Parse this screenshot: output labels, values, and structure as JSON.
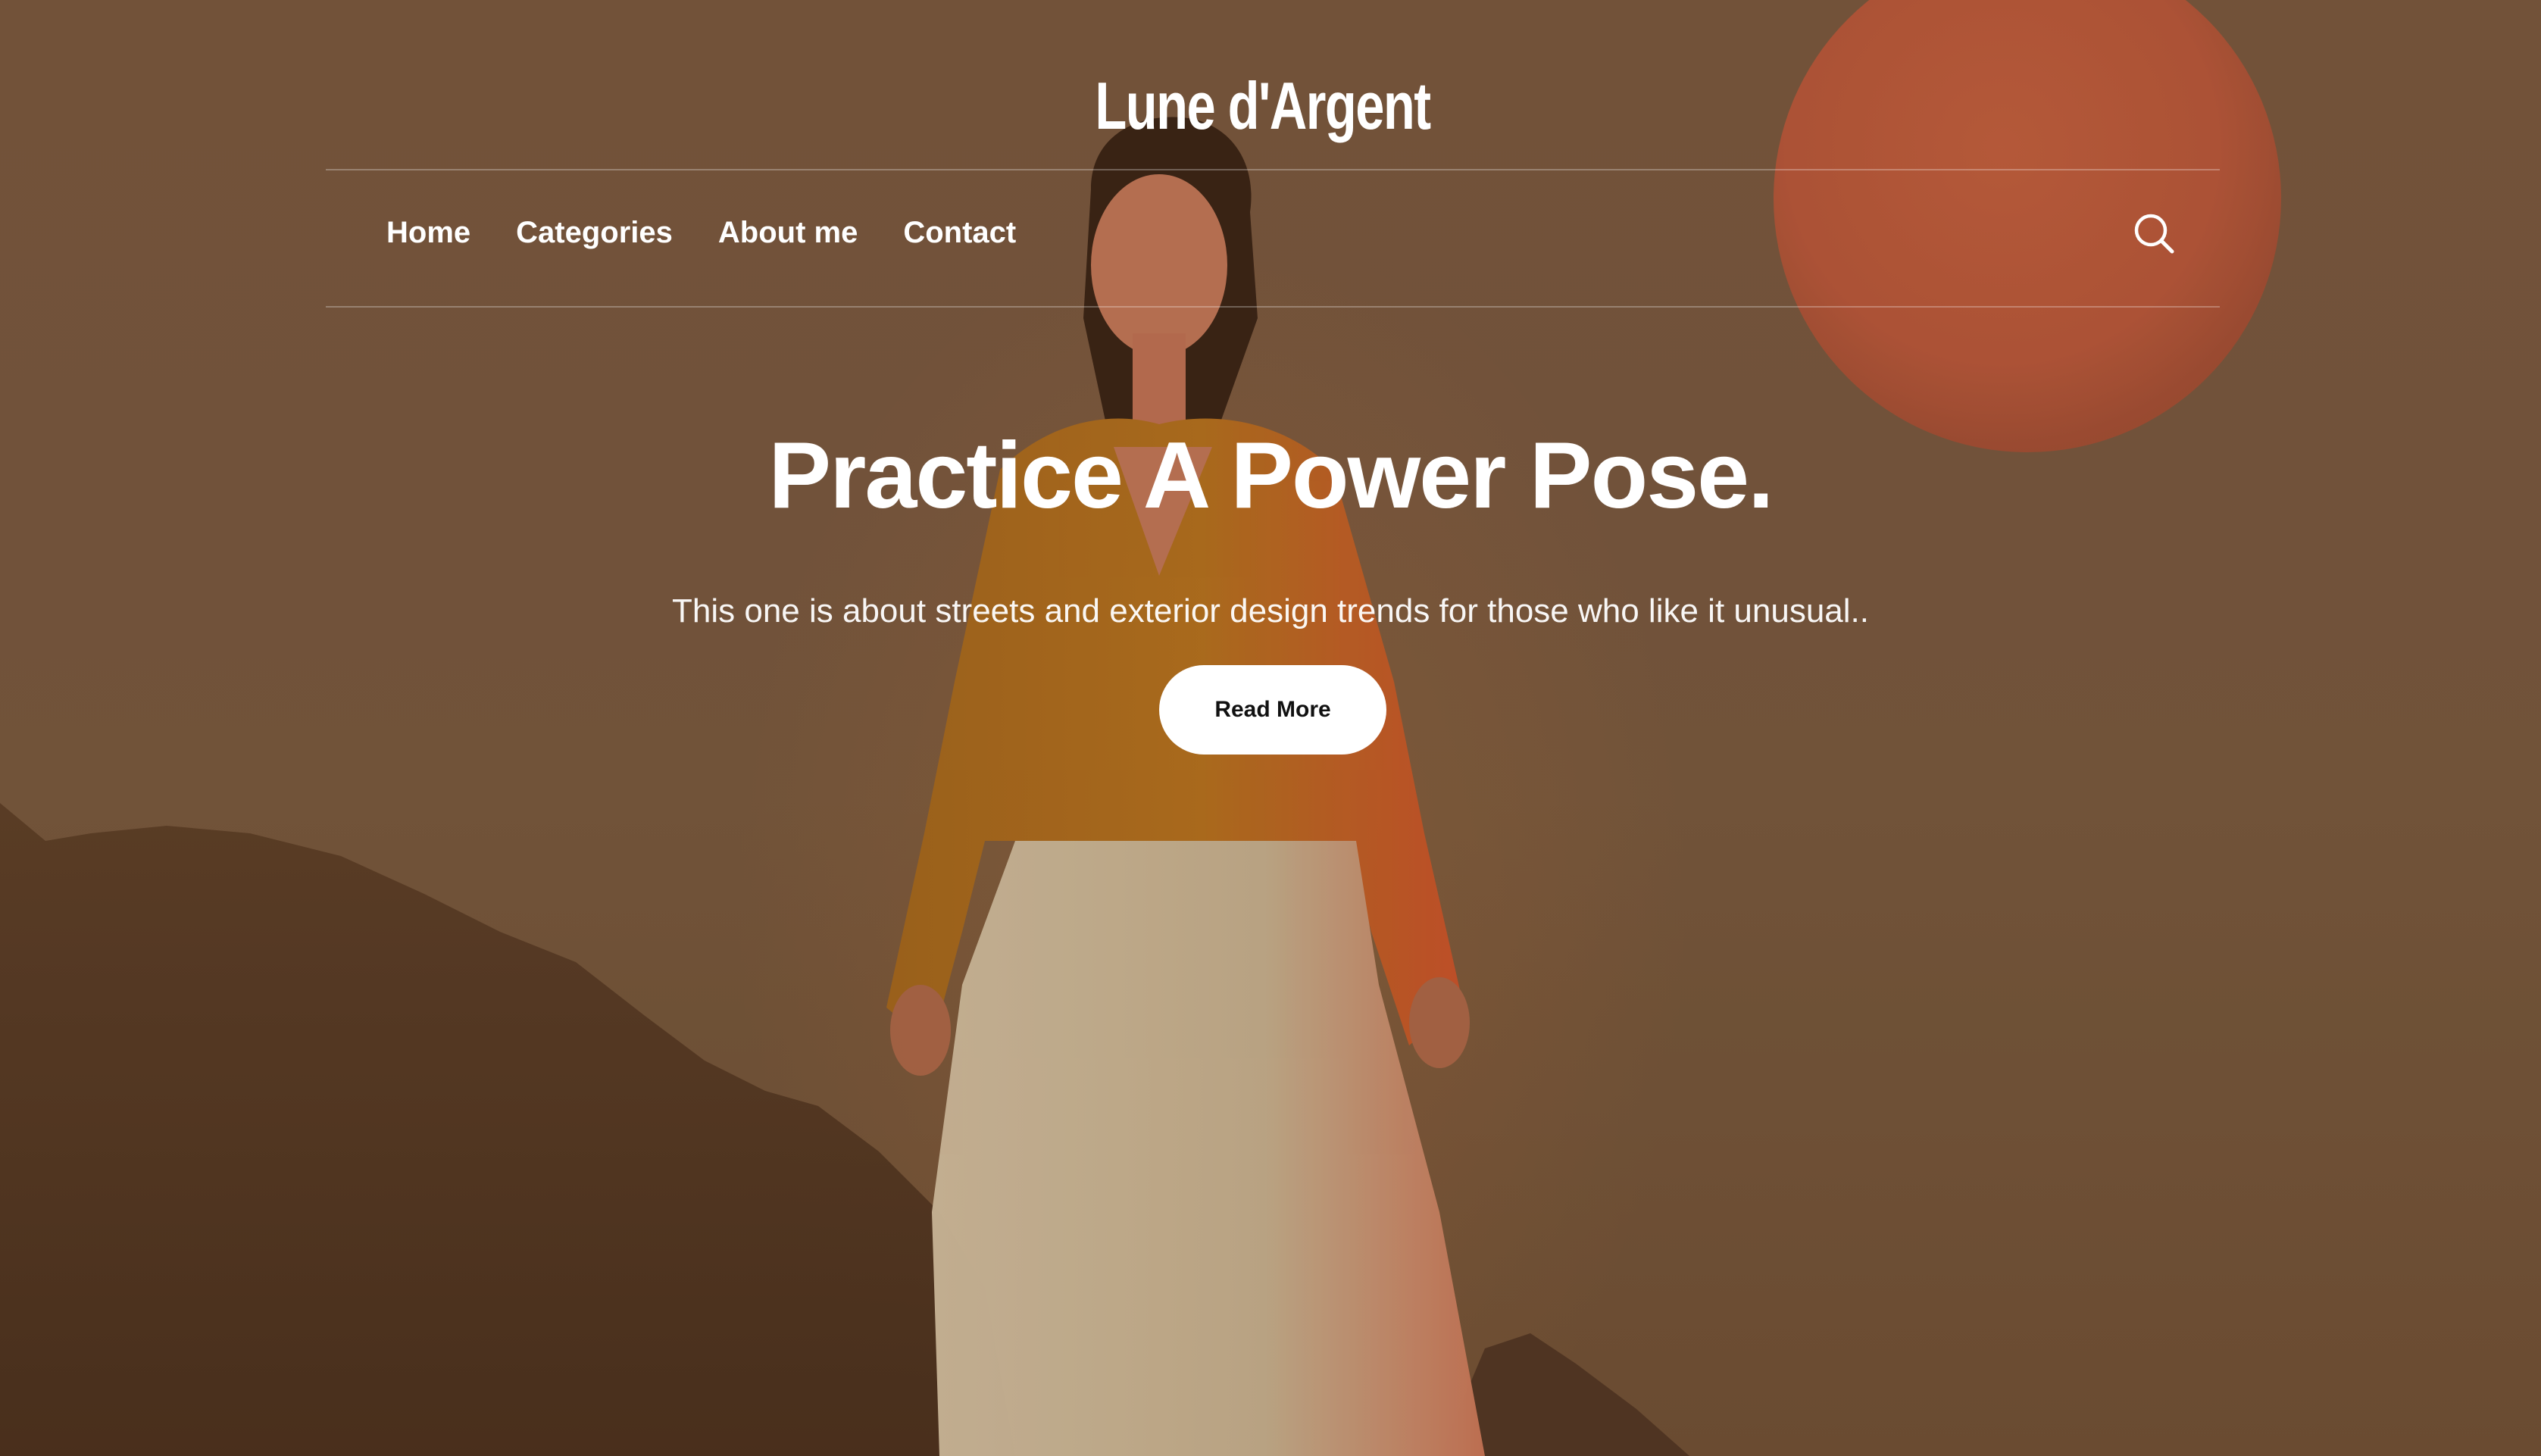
{
  "site": {
    "title": "Lune d'Argent"
  },
  "nav": {
    "items": [
      {
        "label": "Home"
      },
      {
        "label": "Categories"
      },
      {
        "label": "About me"
      },
      {
        "label": "Contact"
      }
    ],
    "search_icon": "search-icon"
  },
  "hero": {
    "headline": "Practice A Power Pose.",
    "subheadline": "This one is about streets and exterior design trends for those who like it unusual..",
    "cta_label": "Read More",
    "image": "woman-in-mustard-shirt-with-red-moon-and-mountains"
  },
  "colors": {
    "background": "#7a5a40",
    "moon": "#c9603e",
    "text": "#ffffff",
    "button_bg": "#ffffff",
    "button_text": "#111111"
  }
}
